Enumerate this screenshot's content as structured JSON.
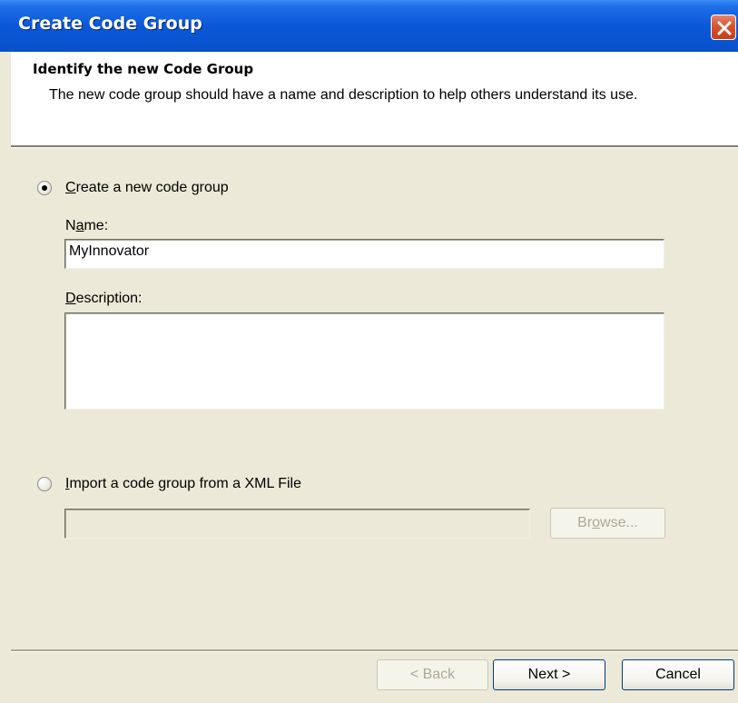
{
  "window": {
    "title": "Create Code Group"
  },
  "header": {
    "title": "Identify the new Code Group",
    "description": "The new code group should have a name and description to help others understand its use."
  },
  "options": {
    "create_new": {
      "label_prefix": "",
      "label_accel": "C",
      "label_rest": "reate a new code group",
      "selected": true
    },
    "import_xml": {
      "label_prefix": "",
      "label_accel": "I",
      "label_rest": "mport a code group from a XML File",
      "selected": false
    }
  },
  "form": {
    "name_label_prefix": "N",
    "name_label_accel": "a",
    "name_label_rest": "me:",
    "name_value": "MyInnovator",
    "description_label_accel": "D",
    "description_label_rest": "escription:",
    "description_value": "",
    "xml_path_value": ""
  },
  "buttons": {
    "browse_prefix": "Br",
    "browse_accel": "o",
    "browse_rest": "wse...",
    "back": "< Back",
    "next": "Next >",
    "cancel": "Cancel"
  },
  "colors": {
    "titlebar": "#0a58d8",
    "dialog_bg": "#ece9d8",
    "close_button": "#d7532e"
  }
}
